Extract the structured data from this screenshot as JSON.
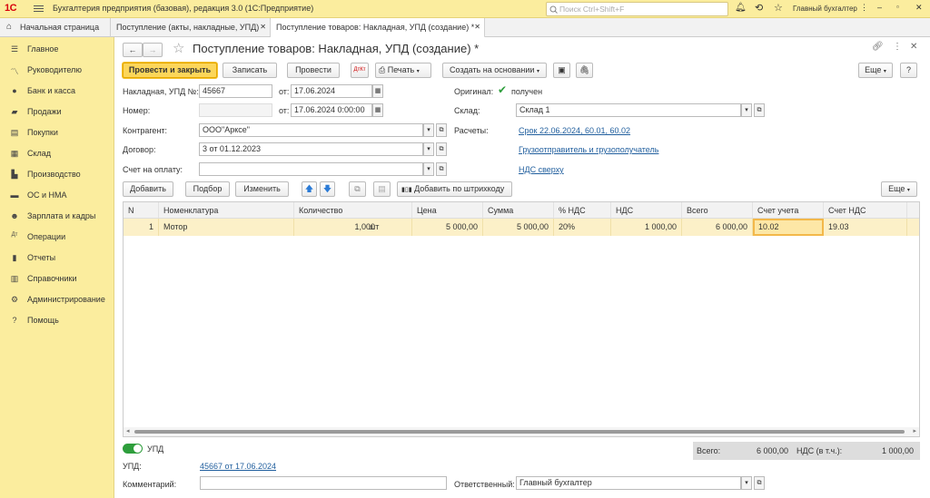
{
  "titlebar": {
    "logo": "1С",
    "menu_icon": "hamburger-icon",
    "title": "Бухгалтерия предприятия (базовая), редакция 3.0  (1С:Предприятие)",
    "search_placeholder": "Поиск Ctrl+Shift+F",
    "user": "Главный бухгалтер"
  },
  "tabs": {
    "home": "Начальная страница",
    "t1": "Поступление (акты, накладные, УПД)",
    "t2": "Поступление товаров: Накладная, УПД (создание) *"
  },
  "sidebar": {
    "items": [
      {
        "label": "Главное",
        "icon": "menu-icon"
      },
      {
        "label": "Руководителю",
        "icon": "chart-icon"
      },
      {
        "label": "Банк и касса",
        "icon": "coin-icon"
      },
      {
        "label": "Продажи",
        "icon": "bag-icon"
      },
      {
        "label": "Покупки",
        "icon": "cart-icon"
      },
      {
        "label": "Склад",
        "icon": "warehouse-icon"
      },
      {
        "label": "Производство",
        "icon": "factory-icon"
      },
      {
        "label": "ОС и НМА",
        "icon": "truck-icon"
      },
      {
        "label": "Зарплата и кадры",
        "icon": "person-icon"
      },
      {
        "label": "Операции",
        "icon": "dt-kt-icon"
      },
      {
        "label": "Отчеты",
        "icon": "report-icon"
      },
      {
        "label": "Справочники",
        "icon": "book-icon"
      },
      {
        "label": "Администрирование",
        "icon": "gear-icon"
      },
      {
        "label": "Помощь",
        "icon": "help-icon"
      }
    ]
  },
  "doc": {
    "title": "Поступление товаров: Накладная, УПД (создание) *"
  },
  "toolbar": {
    "post_close": "Провести и закрыть",
    "save": "Записать",
    "post": "Провести",
    "print": "Печать",
    "create_based": "Создать на основании",
    "more": "Еще",
    "help": "?"
  },
  "form": {
    "invoice_label": "Накладная, УПД №:",
    "invoice_value": "45667",
    "from_label": "от:",
    "date_value": "17.06.2024",
    "number_label": "Номер:",
    "number_value": "",
    "date2_value": "17.06.2024  0:00:00",
    "original_label": "Оригинал:",
    "original_value": "получен",
    "warehouse_label": "Склад:",
    "warehouse_value": "Склад 1",
    "contractor_label": "Контрагент:",
    "contractor_value": "ООО\"Арксе\"",
    "settlements_label": "Расчеты:",
    "settlements_link": "Срок 22.06.2024, 60.01, 60.02",
    "contract_label": "Договор:",
    "contract_value": "3 от 01.12.2023",
    "shipper_link": "Грузоотправитель и грузополучатель",
    "pay_invoice_label": "Счет на оплату:",
    "pay_invoice_value": "",
    "vat_link": "НДС сверху"
  },
  "table_toolbar": {
    "add": "Добавить",
    "pick": "Подбор",
    "edit": "Изменить",
    "barcode": "Добавить по штрихкоду",
    "more": "Еще"
  },
  "table": {
    "headers": [
      "N",
      "Номенклатура",
      "Количество",
      "Цена",
      "Сумма",
      "% НДС",
      "НДС",
      "Всего",
      "Счет учета",
      "Счет НДС"
    ],
    "rows": [
      {
        "n": "1",
        "item": "Мотор",
        "qty": "1,000",
        "unit": "шт",
        "price": "5 000,00",
        "sum": "5 000,00",
        "vat_rate": "20%",
        "vat": "1 000,00",
        "total": "6 000,00",
        "account": "10.02",
        "vat_account": "19.03"
      }
    ]
  },
  "footer": {
    "upd_toggle": "УПД",
    "upd_label": "УПД:",
    "upd_link": "45667 от 17.06.2024",
    "total_label": "Всего:",
    "total_value": "6 000,00",
    "vat_label": "НДС (в т.ч.):",
    "vat_value": "1 000,00",
    "comment_label": "Комментарий:",
    "comment_value": "",
    "responsible_label": "Ответственный:",
    "responsible_value": "Главный бухгалтер"
  }
}
